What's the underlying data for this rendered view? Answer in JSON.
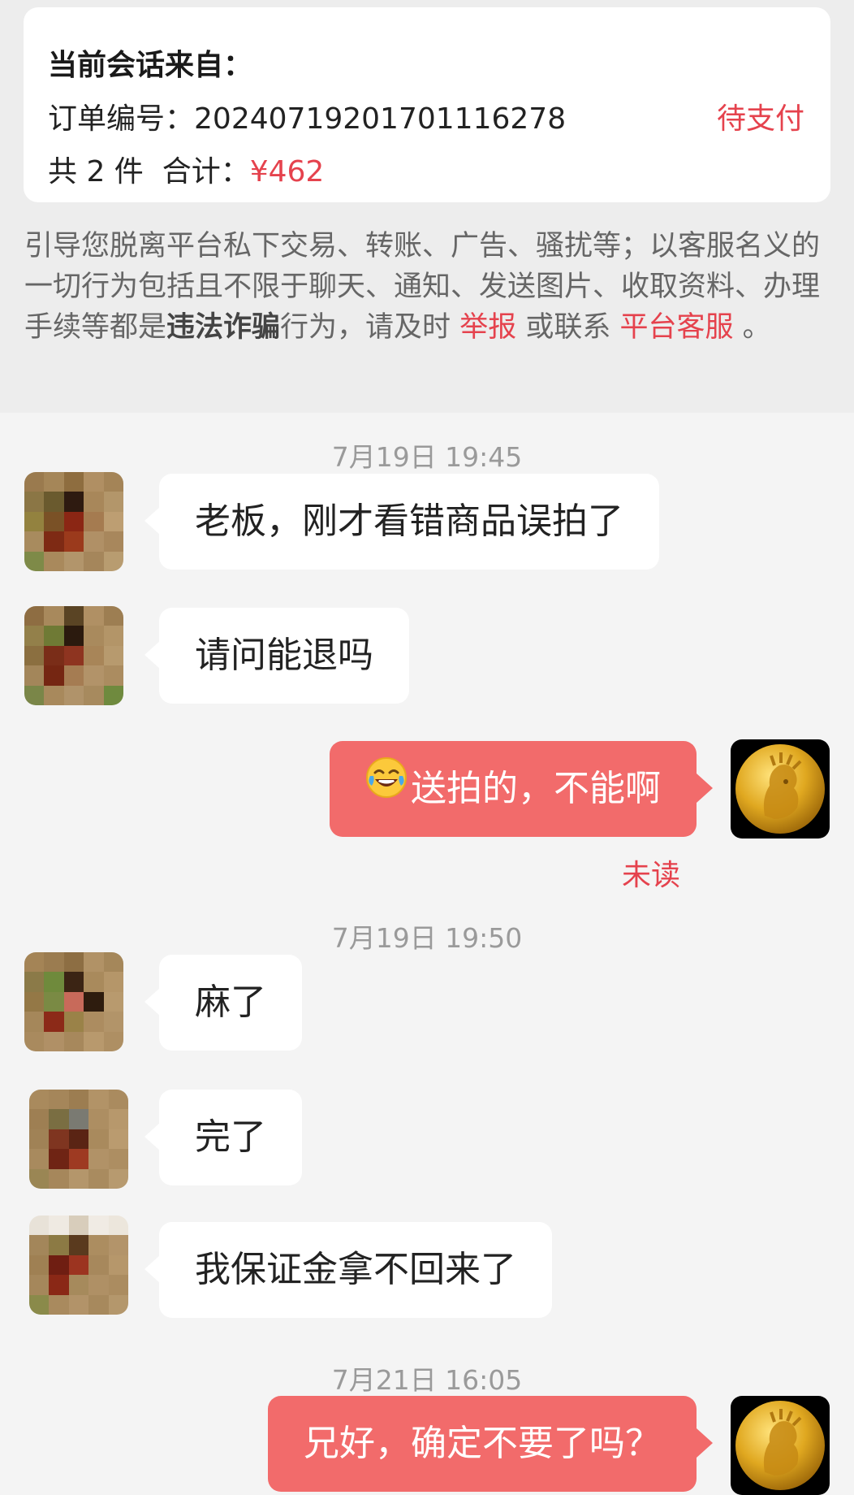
{
  "order": {
    "source_title": "当前会话来自：",
    "order_label": "订单编号：",
    "order_number": "20240719201701116278",
    "status": "待支付",
    "count_text": "共 2 件",
    "total_label": "合计：",
    "total_value": "¥462"
  },
  "warning": {
    "part1": "引导您脱离平台私下交易、转账、广告、骚扰等；以客服名义的一切行为包括且不限于聊天、通知、发送图片、收取资料、办理手续等都是",
    "bold": "违法诈骗",
    "part2": "行为，请及时",
    "report_link": "举报",
    "part3": "或联系",
    "service_link": "平台客服",
    "part4": "。"
  },
  "messages": [
    {
      "timestamp": "7月19日 19:45"
    },
    {
      "from": "buyer",
      "text": "老板，刚才看错商品误拍了"
    },
    {
      "from": "buyer",
      "text": "请问能退吗"
    },
    {
      "from": "seller",
      "emoji": "face-with-tears-of-joy-icon",
      "text": "送拍的，不能啊",
      "read_status": "未读"
    },
    {
      "timestamp": "7月19日 19:50"
    },
    {
      "from": "buyer",
      "text": "麻了"
    },
    {
      "from": "buyer",
      "text": "完了"
    },
    {
      "from": "buyer",
      "text": "我保证金拿不回来了"
    },
    {
      "timestamp": "7月21日 16:05"
    },
    {
      "from": "seller",
      "text": "兄好，确定不要了吗？"
    }
  ],
  "colors": {
    "accent_red": "#e5424d",
    "outgoing_bubble": "#f26b6b",
    "incoming_bubble": "#ffffff",
    "background": "#f4f4f4"
  }
}
